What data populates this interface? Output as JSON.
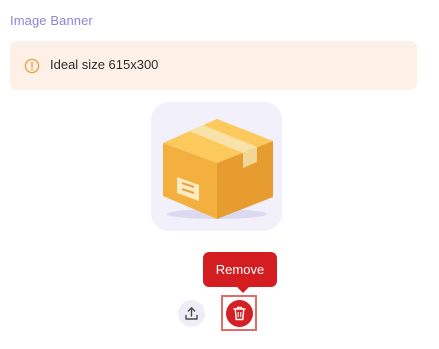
{
  "section": {
    "title": "Image Banner"
  },
  "alert": {
    "icon": "info-circle-icon",
    "text": "Ideal size 615x300",
    "background_color": "#fdf1e7",
    "icon_color": "#f0a040"
  },
  "image_preview": {
    "icon": "package-box-icon",
    "frame_color": "#f1f0fb"
  },
  "tooltip": {
    "text": "Remove",
    "color": "#d31d21"
  },
  "actions": {
    "upload_icon": "upload-icon",
    "delete_icon": "trash-icon",
    "delete_color": "#d41f24"
  }
}
